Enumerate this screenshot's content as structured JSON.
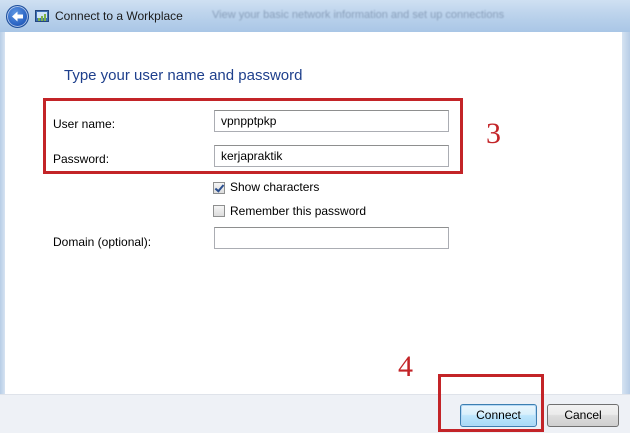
{
  "window": {
    "title": "Connect to a Workplace",
    "background_title_blur": "View your basic network information and set up connections"
  },
  "dialog": {
    "heading": "Type your user name and password",
    "username_label": "User name:",
    "username_value": "vpnpptpkp",
    "password_label": "Password:",
    "password_value": "kerjapraktik",
    "show_characters_label": "Show characters",
    "show_characters_checked": true,
    "remember_password_label": "Remember this password",
    "remember_password_checked": false,
    "domain_label": "Domain (optional):",
    "domain_value": ""
  },
  "buttons": {
    "connect": "Connect",
    "cancel": "Cancel"
  },
  "annotations": {
    "step_credentials": "3",
    "step_connect": "4",
    "color": "#c32428"
  },
  "icons": {
    "back": "back-arrow-icon",
    "app": "network-connection-icon"
  }
}
